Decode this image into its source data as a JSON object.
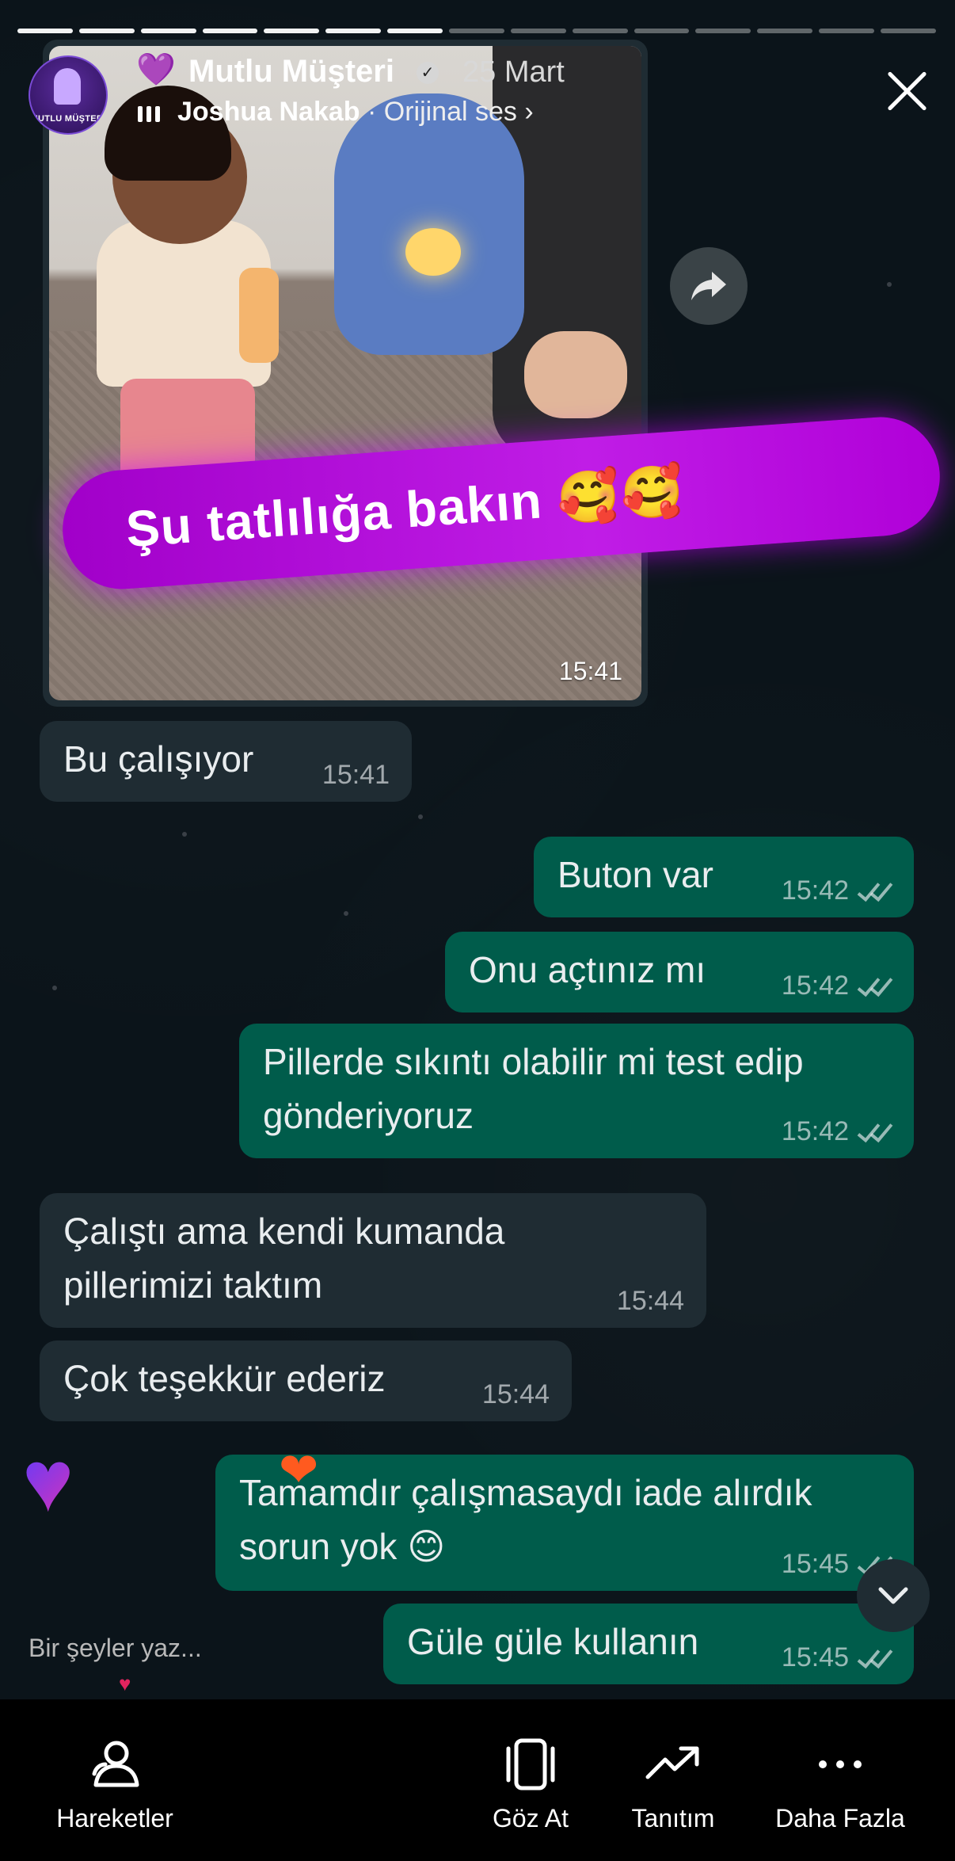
{
  "header": {
    "avatar_label": "MUTLU MÜŞTERİ",
    "heart": "💜",
    "account_name": "Mutlu Müşteri",
    "date": "25 Mart",
    "audio_artist": "Joshua Nakab",
    "audio_suffix": " · Orijinal ses ›"
  },
  "photo": {
    "time": "15:41"
  },
  "sticker": {
    "text": "Şu tatlılığa bakın 🥰🥰"
  },
  "messages": [
    {
      "text": "Bu çalışıyor",
      "time": "15:41"
    },
    {
      "text": "Buton var",
      "time": "15:42"
    },
    {
      "text": "Onu açtınız mı",
      "time": "15:42"
    },
    {
      "text": "Pillerde sıkıntı olabilir mi test edip gönderiyoruz",
      "time": "15:42"
    },
    {
      "text": "Çalıştı ama kendi kumanda pillerimizi taktım",
      "time": "15:44"
    },
    {
      "text": "Çok teşekkür ederiz",
      "time": "15:44"
    },
    {
      "text": "Tamamdır çalışmasaydı iade alırdık sorun yok 😊",
      "time": "15:45"
    },
    {
      "text": "Güle güle kullanın",
      "time": "15:45"
    }
  ],
  "reply": {
    "placeholder": "Bir şeyler yaz..."
  },
  "nav": {
    "activities": "Hareketler",
    "browse": "Göz At",
    "promote": "Tanıtım",
    "more": "Daha Fazla"
  },
  "colors": {
    "incoming_bubble": "#1f2c33",
    "outgoing_bubble": "#005c4b",
    "sticker": "#c01de6",
    "chat_background": "#0b141a"
  }
}
